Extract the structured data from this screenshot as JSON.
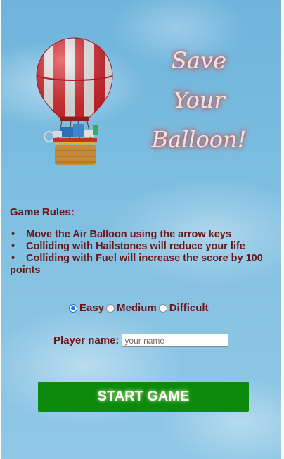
{
  "title": {
    "line1": "Save",
    "line2": "Your",
    "line3": "Balloon!"
  },
  "rules": {
    "heading": "Game Rules:",
    "items": [
      "Move the Air Balloon using the arrow keys",
      "Colliding with Hailstones will reduce your life",
      "Colliding with Fuel will increase the score by 100 points"
    ]
  },
  "difficulty": {
    "options": [
      "Easy",
      "Medium",
      "Difficult"
    ],
    "selected": "Easy"
  },
  "player": {
    "label": "Player name:",
    "placeholder": "your name",
    "value": ""
  },
  "start_button": {
    "label": "START GAME"
  },
  "icons": {
    "balloon": "hot-air-balloon-icon"
  },
  "colors": {
    "text": "#6b1515",
    "button": "#0b8a0b",
    "title_glow": "#b33b3b",
    "radio_selected": "#1a73e8"
  }
}
